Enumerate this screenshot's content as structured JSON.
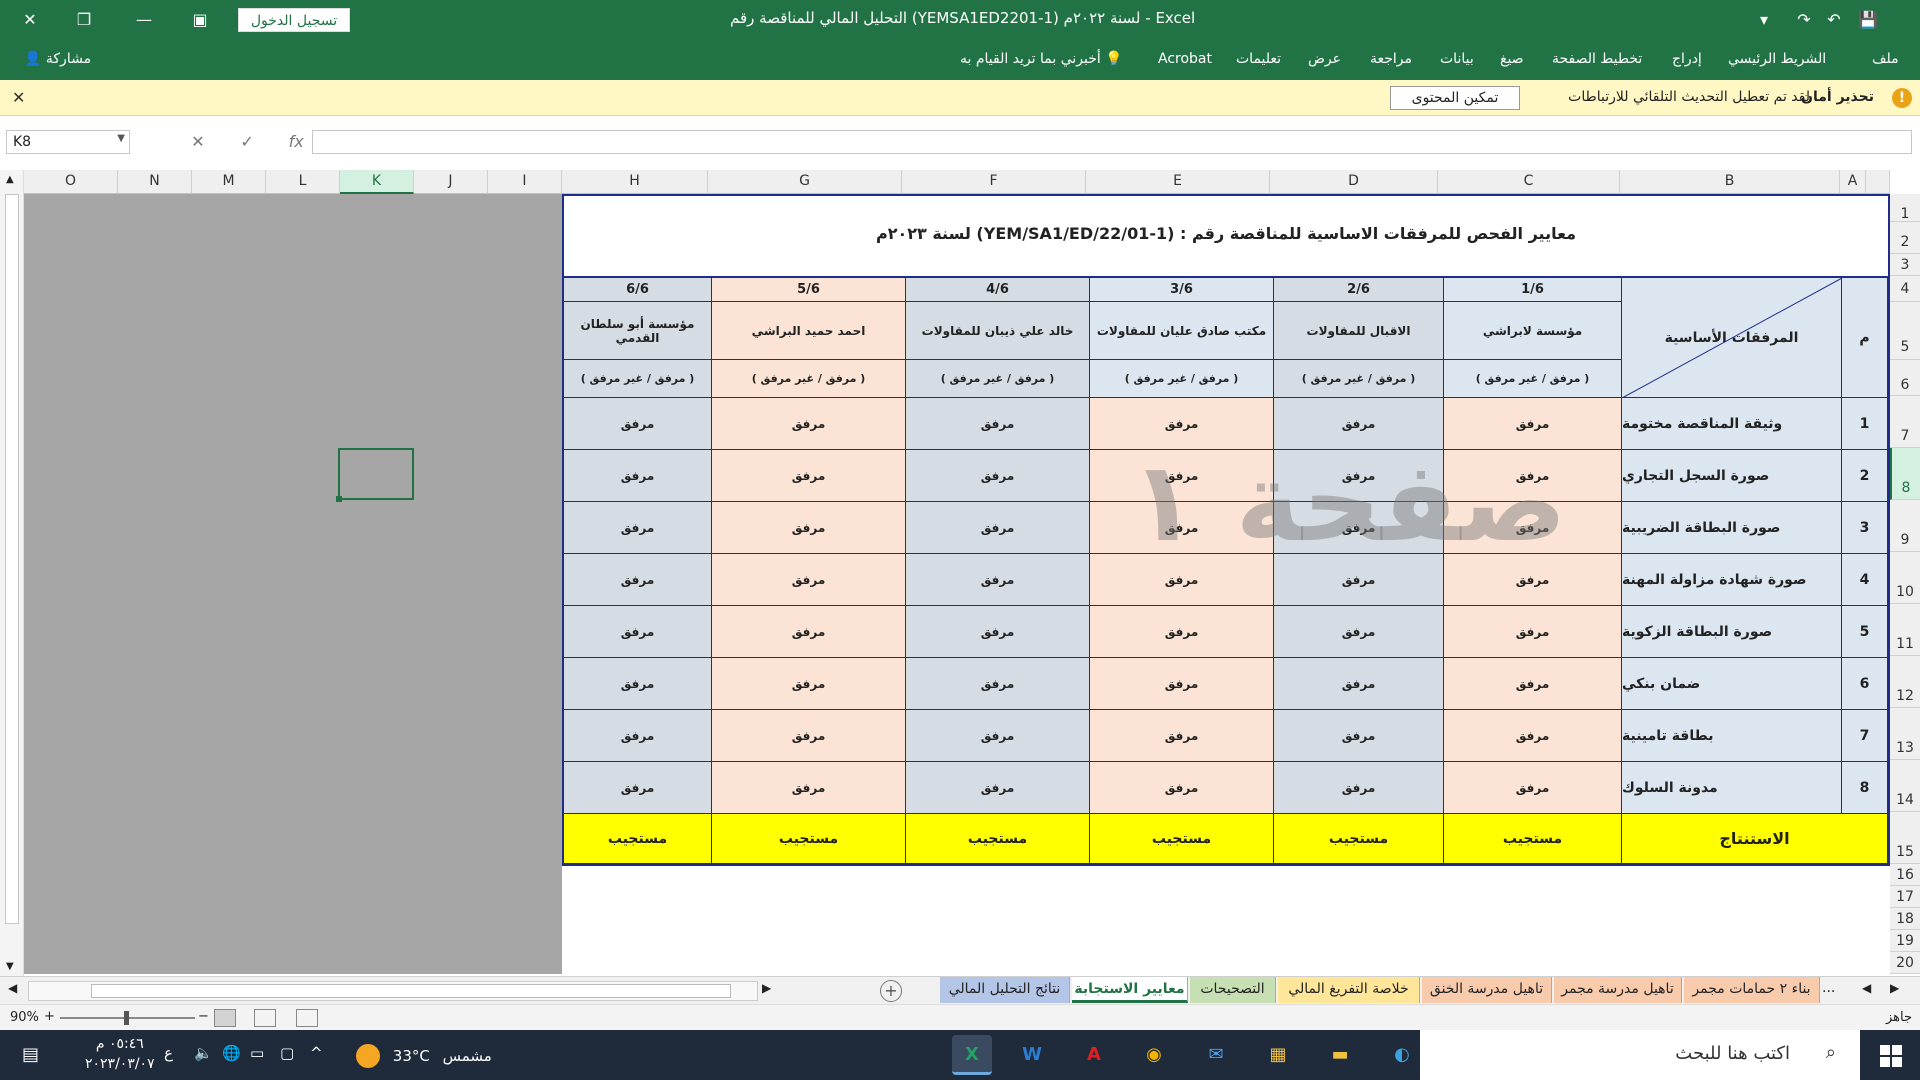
{
  "window": {
    "title": "التحليل المالي للمناقصة رقم  (YEMSA1ED2201-1) لسنة ٢٠٢٢م  -  Excel",
    "signin": "تسجيل الدخول"
  },
  "ribbon": {
    "items": [
      "ملف",
      "الشريط الرئيسي",
      "إدراج",
      "تخطيط الصفحة",
      "صيغ",
      "بيانات",
      "مراجعة",
      "عرض",
      "تعليمات",
      "Acrobat",
      "أخبرني بما تريد القيام به"
    ],
    "share": "مشاركة"
  },
  "security": {
    "title": "تحذير أمان",
    "message": "لقد تم تعطيل التحديث التلقائي للارتباطات",
    "button": "تمكين المحتوى"
  },
  "formula": {
    "namebox": "K8",
    "fx": "fx",
    "value": ""
  },
  "columns": [
    "A",
    "B",
    "C",
    "D",
    "E",
    "F",
    "G",
    "H",
    "I",
    "J",
    "K",
    "L",
    "M",
    "N",
    "O"
  ],
  "rows": [
    "1",
    "2",
    "3",
    "4",
    "5",
    "6",
    "7",
    "8",
    "9",
    "10",
    "11",
    "12",
    "13",
    "14",
    "15",
    "16",
    "17",
    "18",
    "19",
    "20"
  ],
  "selected_cell": "K8",
  "sheet": {
    "title": "معايير الفحص للمرفقات  الاساسية للمناقصة رقم : (YEM/SA1/ED/22/01-1) لسنة ٢٠٢٣م",
    "num_header": "م",
    "diag_header": "المرفقات الأساسية",
    "bidders": [
      {
        "index": "1/6",
        "name": "مؤسسة لابراشي",
        "status": "( مرفق / غير مرفق )"
      },
      {
        "index": "2/6",
        "name": "الاقبال للمقاولات",
        "status": "( مرفق / غير مرفق )"
      },
      {
        "index": "3/6",
        "name": "مكتب صادق عليان للمقاولات",
        "status": "( مرفق / غير مرفق )"
      },
      {
        "index": "4/6",
        "name": "خالد علي ذيبان للمقاولات",
        "status": "( مرفق / غير مرفق )"
      },
      {
        "index": "5/6",
        "name": "احمد حميد البراشي",
        "status": "( مرفق / غير مرفق )"
      },
      {
        "index": "6/6",
        "name": "مؤسسة أبو سلطان القدمي",
        "status": "( مرفق / غير مرفق )"
      }
    ],
    "items": [
      {
        "num": "1",
        "label": "وثيقة المناقصة مختومة",
        "values": [
          "مرفق",
          "مرفق",
          "مرفق",
          "مرفق",
          "مرفق",
          "مرفق"
        ]
      },
      {
        "num": "2",
        "label": "صورة السجل التجاري",
        "values": [
          "مرفق",
          "مرفق",
          "مرفق",
          "مرفق",
          "مرفق",
          "مرفق"
        ]
      },
      {
        "num": "3",
        "label": "صورة البطاقة الضريبية",
        "values": [
          "مرفق",
          "مرفق",
          "مرفق",
          "مرفق",
          "مرفق",
          "مرفق"
        ]
      },
      {
        "num": "4",
        "label": "صورة شهادة مزاولة المهنة",
        "values": [
          "مرفق",
          "مرفق",
          "مرفق",
          "مرفق",
          "مرفق",
          "مرفق"
        ]
      },
      {
        "num": "5",
        "label": "صورة البطاقة الزكوية",
        "values": [
          "مرفق",
          "مرفق",
          "مرفق",
          "مرفق",
          "مرفق",
          "مرفق"
        ]
      },
      {
        "num": "6",
        "label": "ضمان بنكي",
        "values": [
          "مرفق",
          "مرفق",
          "مرفق",
          "مرفق",
          "مرفق",
          "مرفق"
        ]
      },
      {
        "num": "7",
        "label": "بطاقة تامينية",
        "values": [
          "مرفق",
          "مرفق",
          "مرفق",
          "مرفق",
          "مرفق",
          "مرفق"
        ]
      },
      {
        "num": "8",
        "label": "مدونة السلوك",
        "values": [
          "مرفق",
          "مرفق",
          "مرفق",
          "مرفق",
          "مرفق",
          "مرفق"
        ]
      }
    ],
    "conclusion_label": "الاستنتاج",
    "conclusions": [
      "مستجيب",
      "مستجيب",
      "مستجيب",
      "مستجيب",
      "مستجيب",
      "مستجيب"
    ],
    "watermark": "صفحة ١"
  },
  "tabs": {
    "items": [
      "بناء ٢ حمامات مجمر",
      "تاهيل مدرسة مجمر",
      "تاهيل مدرسة الخنق",
      "خلاصة التفريغ المالي",
      "التصحيحات",
      "معايير الاستجابة",
      "نتائج التحليل المالي"
    ],
    "more": "...",
    "add": "+"
  },
  "status": {
    "ready": "جاهز",
    "zoom": "90%"
  },
  "taskbar": {
    "search": "اكتب هنا للبحث",
    "weather_label": "مشمس",
    "temperature": "33°C",
    "lang": "ع",
    "time": "٠٥:٤٦ م",
    "date": "٢٠٢٣/٠٣/٠٧"
  },
  "colors": {
    "excel_green": "#217346",
    "blue_fill": "#dce6f1",
    "peach_fill": "#fbe4d5",
    "grey_fill": "#d6dce4",
    "yellow_fill": "#ffff00",
    "border_navy": "#1f2d8a"
  }
}
